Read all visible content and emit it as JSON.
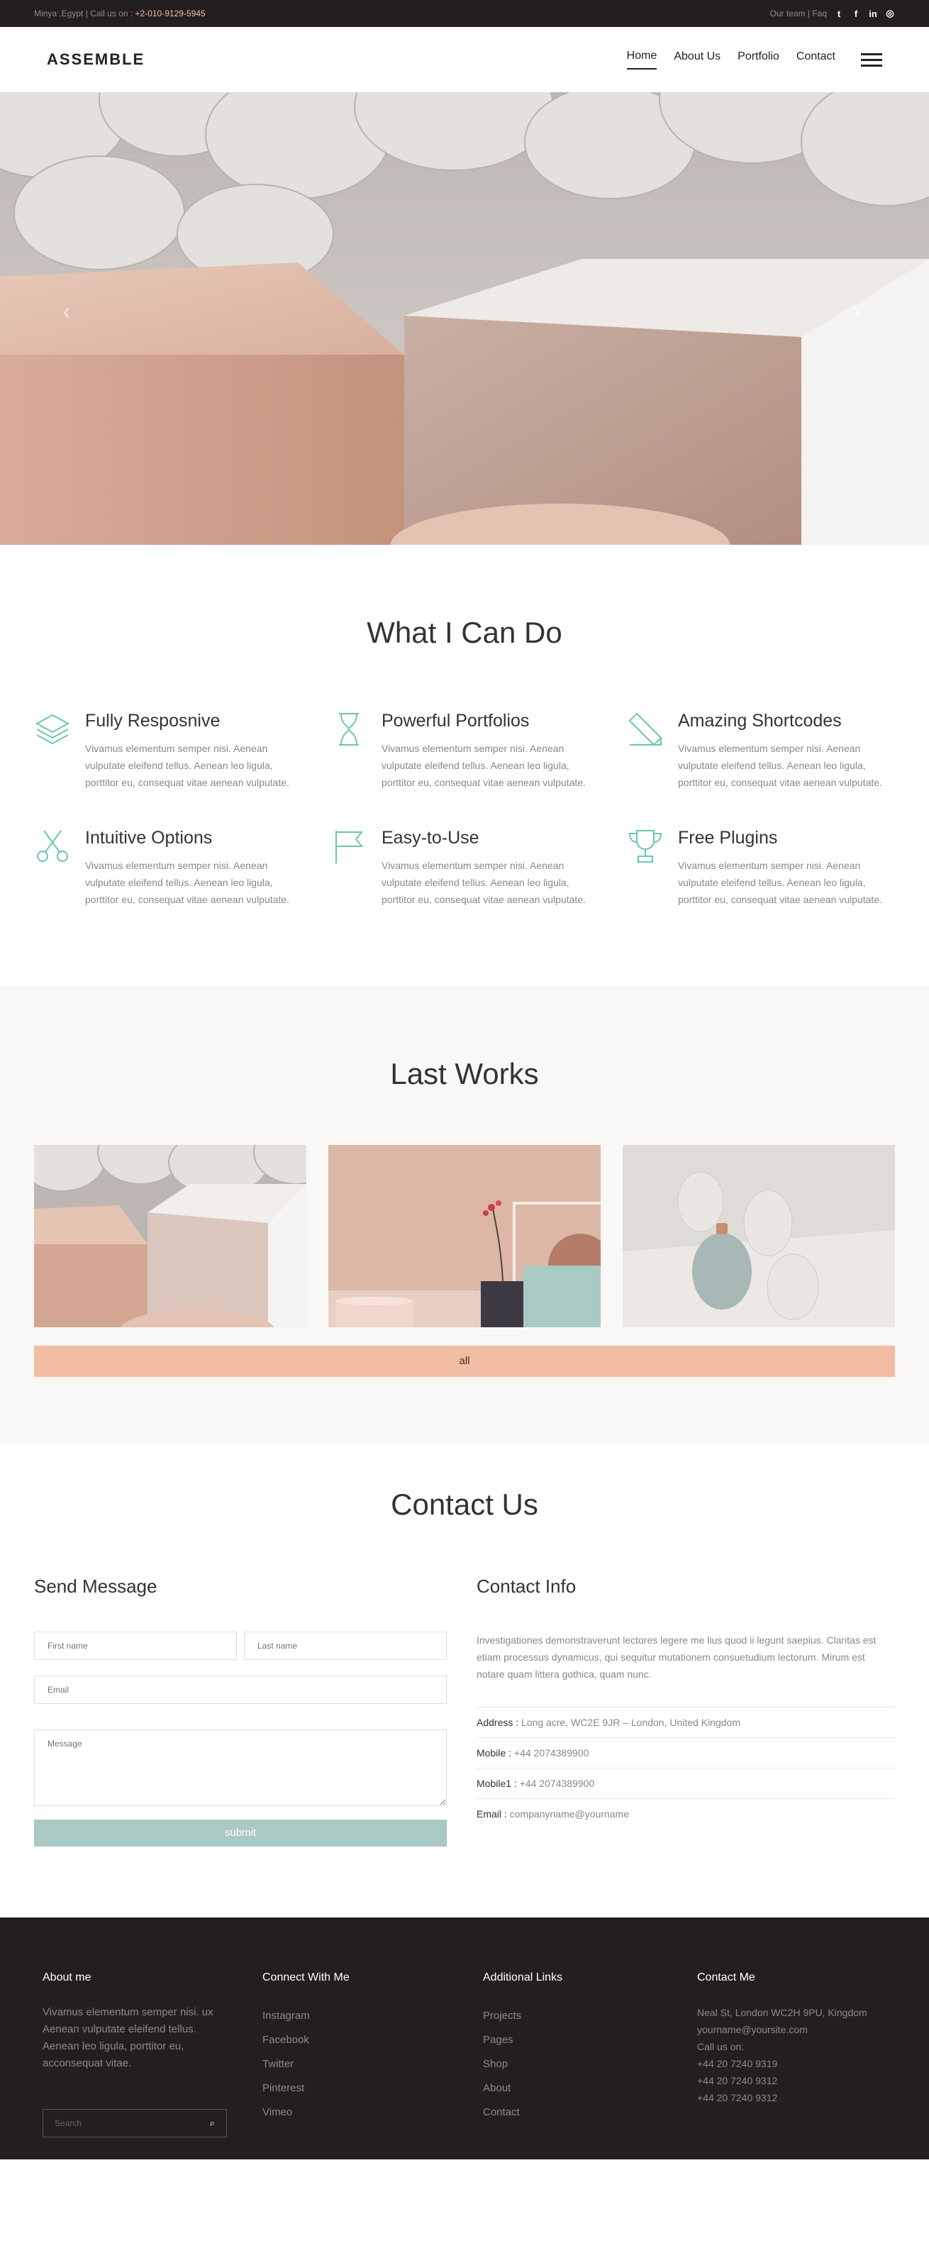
{
  "topbar": {
    "location": "Minya ,Egypt | Call us on :",
    "phone": "+2-010-9129-5945",
    "links": "Our team | Faq",
    "social": [
      {
        "icon": "twitter-icon",
        "glyph": "t"
      },
      {
        "icon": "facebook-icon",
        "glyph": "f"
      },
      {
        "icon": "linkedin-icon",
        "glyph": "in"
      },
      {
        "icon": "instagram-icon",
        "glyph": "◎"
      }
    ]
  },
  "header": {
    "logo": "ASSEMBLE",
    "nav": [
      "Home",
      "About Us",
      "Portfolio",
      "Contact"
    ],
    "menu_icon": "hamburger-menu-icon"
  },
  "hero": {
    "prev_icon": "chevron-left-icon",
    "next_icon": "chevron-right-icon",
    "prev_glyph": "‹",
    "next_glyph": "›"
  },
  "services": {
    "title": "What I Can Do",
    "items": [
      {
        "title": "Fully Resposnive",
        "icon": "layers-icon",
        "text": "Vivamus elementum semper nisi. Aenean vulputate eleifend tellus. Aenean leo ligula, porttitor eu, consequat vitae aenean vulputate."
      },
      {
        "title": "Powerful Portfolios",
        "icon": "hourglass-icon",
        "text": "Vivamus elementum semper nisi. Aenean vulputate eleifend tellus. Aenean leo ligula, porttitor eu, consequat vitae aenean vulputate."
      },
      {
        "title": "Amazing Shortcodes",
        "icon": "pencil-icon",
        "text": "Vivamus elementum semper nisi. Aenean vulputate eleifend tellus. Aenean leo ligula, porttitor eu, consequat vitae aenean vulputate."
      },
      {
        "title": "Intuitive Options",
        "icon": "scissors-icon",
        "text": "Vivamus elementum semper nisi. Aenean vulputate eleifend tellus. Aenean leo ligula, porttitor eu, consequat vitae aenean vulputate."
      },
      {
        "title": "Easy-to-Use",
        "icon": "flag-icon",
        "text": "Vivamus elementum semper nisi. Aenean vulputate eleifend tellus. Aenean leo ligula, porttitor eu, consequat vitae aenean vulputate."
      },
      {
        "title": "Free Plugins",
        "icon": "trophy-icon",
        "text": "Vivamus elementum semper nisi. Aenean vulputate eleifend tellus. Aenean leo ligula, porttitor eu, consequat vitae aenean vulputate."
      }
    ],
    "icon_color": "#6cc5b0"
  },
  "works": {
    "title": "Last Works",
    "filter_label": "all"
  },
  "contact": {
    "title": "Contact Us",
    "form": {
      "title": "Send Message",
      "first_name_placeholder": "First name",
      "last_name_placeholder": "Last name",
      "email_placeholder": "Email",
      "message_placeholder": "Message",
      "submit_label": "submit"
    },
    "info": {
      "title": "Contact Info",
      "text": "Investigationes demonstraverunt lectores legere me lius quod ii legunt saepius. Claritas est etiam processus dynamicus, qui sequitur mutationem consuetudium lectorum. Mirum est notare quam littera gothica, quam nunc.",
      "lines": [
        {
          "label": "Address :",
          "value": " Long acre, WC2E 9JR – London, United Kingdom"
        },
        {
          "label": "Mobile :",
          "value": " +44 2074389900"
        },
        {
          "label": "Mobile1 :",
          "value": " +44 2074389900"
        },
        {
          "label": "Email :",
          "value": " companyname@yourname"
        }
      ]
    }
  },
  "footer": {
    "about": {
      "title": "About me",
      "text": "Vivamus elementum semper nisi. ux Aenean vulputate eleifend tellus. Aenean leo ligula, porttitor eu, acconsequat vitae.",
      "search_placeholder": "Search",
      "search_icon": "search-icon",
      "search_glyph": "⌕"
    },
    "connect": {
      "title": "Connect With Me",
      "links": [
        "Instagram",
        "Facebook",
        "Twitter",
        "Pinterest",
        "Vimeo"
      ]
    },
    "additional": {
      "title": "Additional Links",
      "links": [
        "Projects",
        "Pages",
        "Shop",
        "About",
        "Contact"
      ]
    },
    "contact_me": {
      "title": "Contact Me",
      "lines": [
        "Neal St, London WC2H 9PU, Kingdom",
        "yourname@yoursite.com",
        "Call us on:",
        "+44 20 7240 9319",
        "+44 20 7240 9312",
        "+44 20 7240 9312"
      ]
    }
  },
  "colors": {
    "accent": "#f3bda4",
    "teal": "#a9c9c4",
    "dark": "#231f20"
  }
}
